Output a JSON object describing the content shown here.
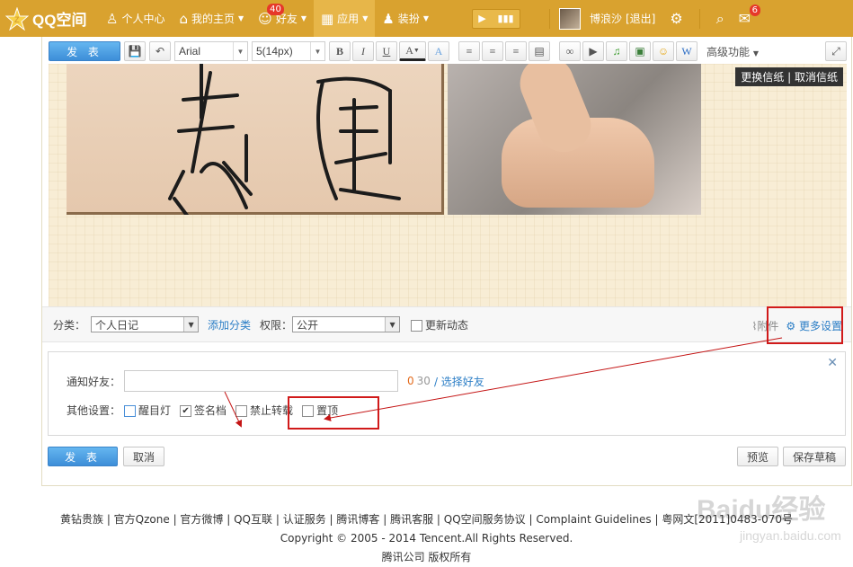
{
  "topbar": {
    "logo_text": "QQ空间",
    "nav": [
      {
        "label": "个人中心",
        "icon": "user-icon"
      },
      {
        "label": "我的主页",
        "icon": "home-icon"
      },
      {
        "label": "好友",
        "icon": "friends-icon",
        "badge": "40"
      },
      {
        "label": "应用",
        "icon": "apps-grid-icon"
      },
      {
        "label": "装扮",
        "icon": "tshirt-icon"
      }
    ],
    "username": "博浪沙",
    "logout": "[退出]",
    "mail_badge": "6",
    "colors": {
      "bar": "#d9a22f",
      "active": "#e7b649",
      "badge": "#e6382a"
    }
  },
  "toolbar": {
    "publish_label": "发 表",
    "font_family": "Arial",
    "font_size": "5(14px)",
    "bold": "B",
    "italic": "I",
    "underline": "U",
    "font_color": "A",
    "clear_format": "A",
    "advanced_label": "高级功能"
  },
  "canvas": {
    "change_paper": "更换信纸",
    "cancel_paper": "取消信纸",
    "divider": "|",
    "calligraphy_text": "馬圜"
  },
  "options": {
    "category_label": "分类：",
    "category_value": "个人日记",
    "add_category": "添加分类",
    "permission_label": "权限：",
    "permission_value": "公开",
    "update_feed": "更新动态",
    "attachment": "附件",
    "more_settings": "更多设置"
  },
  "notify": {
    "friends_label": "通知好友：",
    "count_current": "0",
    "count_max": "30",
    "select_friends": "/ 选择好友",
    "other_label": "其他设置：",
    "checkboxes": [
      {
        "label": "醒目灯",
        "checked": false
      },
      {
        "label": "签名档",
        "checked": true
      },
      {
        "label": "禁止转载",
        "checked": false
      },
      {
        "label": "置顶",
        "checked": false
      }
    ]
  },
  "bottom": {
    "publish": "发 表",
    "cancel": "取消",
    "preview": "预览",
    "save_draft": "保存草稿"
  },
  "footer": {
    "links": [
      "黄钻贵族",
      "官方Qzone",
      "官方微博",
      "QQ互联",
      "认证服务",
      "腾讯博客",
      "腾讯客服",
      "QQ空间服务协议",
      "Complaint Guidelines",
      "粤网文[2011]0483-070号"
    ],
    "copyright": "Copyright © 2005 - 2014 Tencent.All Rights Reserved.",
    "company": "腾讯公司 版权所有"
  },
  "watermark": {
    "brand": "Baidu经验",
    "url": "jingyan.baidu.com"
  }
}
